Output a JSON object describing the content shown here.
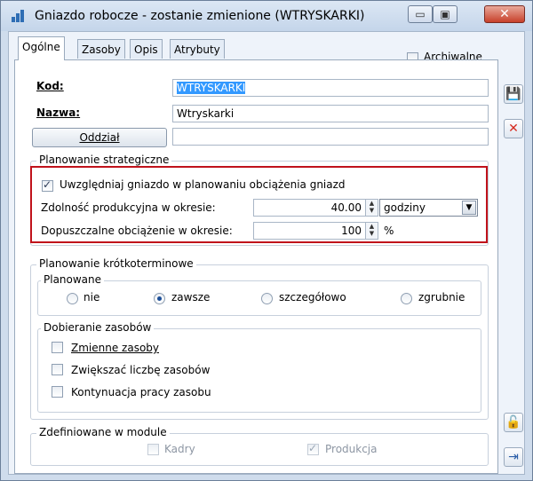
{
  "window": {
    "title": "Gniazdo robocze - zostanie zmienione  (WTRYSKARKI)",
    "min_glyph": "▭",
    "max_glyph": "▣",
    "close_glyph": "✕"
  },
  "tabs": [
    {
      "label": "Ogólne",
      "active": true
    },
    {
      "label": "Zasoby",
      "active": false
    },
    {
      "label": "Opis",
      "active": false
    },
    {
      "label": "Atrybuty",
      "active": false
    }
  ],
  "archived": {
    "label": "Archiwalne",
    "checked": false
  },
  "form": {
    "code_label": "Kod:",
    "code_value": "WTRYSKARKI",
    "name_label": "Nazwa:",
    "name_value": "Wtryskarki",
    "branch_button": "Oddział",
    "branch_value": ""
  },
  "strategic": {
    "legend": "Planowanie strategiczne",
    "include_label": "Uwzględniaj gniazdo w planowaniu obciążenia gniazd",
    "include_checked": true,
    "capacity_label": "Zdolność produkcyjna w okresie:",
    "capacity_value": "40.00",
    "capacity_unit": "godziny",
    "load_label": "Dopuszczalne obciążenie w okresie:",
    "load_value": "100",
    "load_unit": "%"
  },
  "shortterm": {
    "legend": "Planowanie krótkoterminowe",
    "planned": {
      "legend": "Planowane",
      "options": [
        "nie",
        "zawsze",
        "szczegółowo",
        "zgrubnie"
      ],
      "selected": "zawsze"
    },
    "resources": {
      "legend": "Dobieranie zasobów",
      "items": [
        {
          "label": "Zmienne zasoby",
          "checked": false
        },
        {
          "label": "Zwiększać liczbę zasobów",
          "checked": false
        },
        {
          "label": "Kontynuacja pracy zasobu",
          "checked": false
        }
      ]
    }
  },
  "module": {
    "legend": "Zdefiniowane w module",
    "items": [
      {
        "label": "Kadry",
        "checked": false
      },
      {
        "label": "Produkcja",
        "checked": true
      }
    ]
  },
  "side_buttons": {
    "save_icon": "💾",
    "cancel_icon": "✕",
    "lock_icon": "🔓",
    "pin_icon": "⇥"
  },
  "colors": {
    "highlight_border": "#c0121b",
    "selection": "#3399ff",
    "cancel_red": "#d62b1f"
  }
}
